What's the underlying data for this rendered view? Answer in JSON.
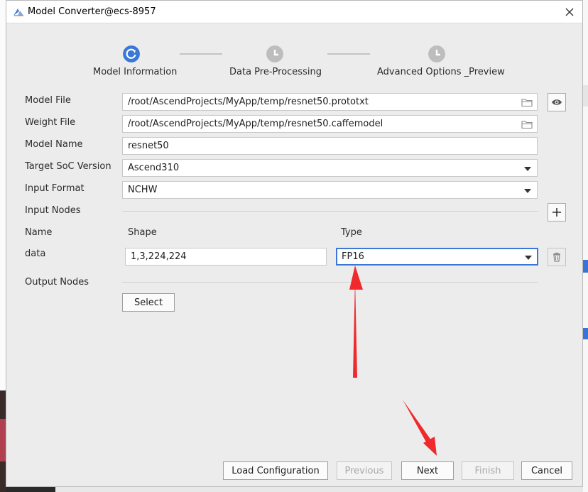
{
  "window": {
    "title": "Model Converter@ecs-8957"
  },
  "stepper": {
    "steps": [
      {
        "label": "Model Information",
        "state": "active"
      },
      {
        "label": "Data Pre-Processing",
        "state": "pending"
      },
      {
        "label": "Advanced Options _Preview",
        "state": "pending"
      }
    ]
  },
  "form": {
    "model_file": {
      "label": "Model File",
      "value": "/root/AscendProjects/MyApp/temp/resnet50.prototxt"
    },
    "weight_file": {
      "label": "Weight File",
      "value": "/root/AscendProjects/MyApp/temp/resnet50.caffemodel"
    },
    "model_name": {
      "label": "Model Name",
      "value": "resnet50"
    },
    "target_soc": {
      "label": "Target SoC Version",
      "value": "Ascend310"
    },
    "input_format": {
      "label": "Input Format",
      "value": "NCHW"
    },
    "input_nodes": {
      "label": "Input Nodes",
      "columns": {
        "name": "Name",
        "shape": "Shape",
        "type": "Type"
      },
      "rows": [
        {
          "name": "data",
          "shape": "1,3,224,224",
          "type": "FP16"
        }
      ]
    },
    "output_nodes": {
      "label": "Output Nodes",
      "select_label": "Select"
    }
  },
  "footer": {
    "load_configuration": "Load Configuration",
    "previous": "Previous",
    "next": "Next",
    "finish": "Finish",
    "cancel": "Cancel"
  },
  "colors": {
    "accent": "#3a77d6",
    "step_pending": "#bdbdbd",
    "annotation_arrow": "#f0292d"
  },
  "icons": [
    "app-icon",
    "close-icon",
    "folder-icon",
    "eye-icon",
    "plus-icon",
    "trash-icon",
    "chevron-down-icon",
    "step-progress-icon",
    "step-clock-icon"
  ]
}
